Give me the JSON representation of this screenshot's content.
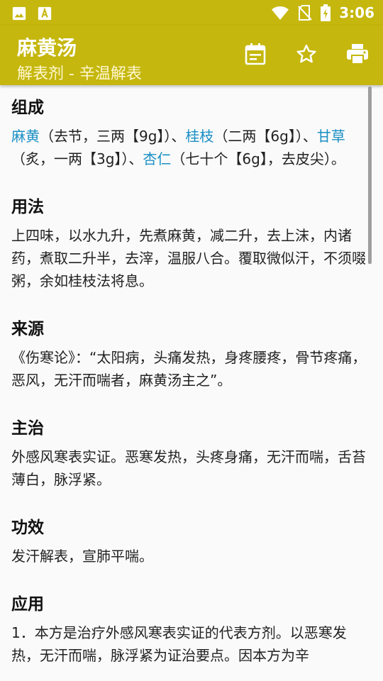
{
  "status_bar": {
    "time": "3:06",
    "left_icons": [
      "image-icon",
      "font-icon"
    ],
    "right_icons": [
      "wifi-icon",
      "no-sim-icon",
      "battery-charging-icon"
    ]
  },
  "app_bar": {
    "title": "麻黄汤",
    "subtitle": "解表剂 - 辛温解表",
    "actions": [
      "calendar-icon",
      "star-icon",
      "print-icon"
    ],
    "color": "#c5b70d"
  },
  "sections": {
    "composition": {
      "heading": "组成",
      "herb1": "麻黄",
      "text1": "（去节，三两【9g】）、",
      "herb2": "桂枝",
      "text2": "（二两【6g】）、",
      "herb3": "甘草",
      "text3": "（炙，一两【3g】）、",
      "herb4": "杏仁",
      "text4": "（七十个【6g】，去皮尖）。"
    },
    "usage": {
      "heading": "用法",
      "body": "上四味，以水九升，先煮麻黄，减二升，去上沫，内诸药，煮取二升半，去滓，温服八合。覆取微似汗，不须啜粥，余如桂枝法将息。"
    },
    "source": {
      "heading": "来源",
      "body": "《伤寒论》：“太阳病，头痛发热，身疼腰疼，骨节疼痛，恶风，无汗而喘者，麻黄汤主之”。"
    },
    "indication": {
      "heading": "主治",
      "body": "外感风寒表实证。恶寒发热，头疼身痛，无汗而喘，舌苔薄白，脉浮紧。"
    },
    "effect": {
      "heading": "功效",
      "body": "发汗解表，宣肺平喘。"
    },
    "application": {
      "heading": "应用",
      "body": "1．本方是治疗外感风寒表实证的代表方剂。以恶寒发热，无汗而喘，脉浮紧为证治要点。因本方为辛"
    }
  },
  "colors": {
    "herb_link": "#1a8fc4"
  }
}
